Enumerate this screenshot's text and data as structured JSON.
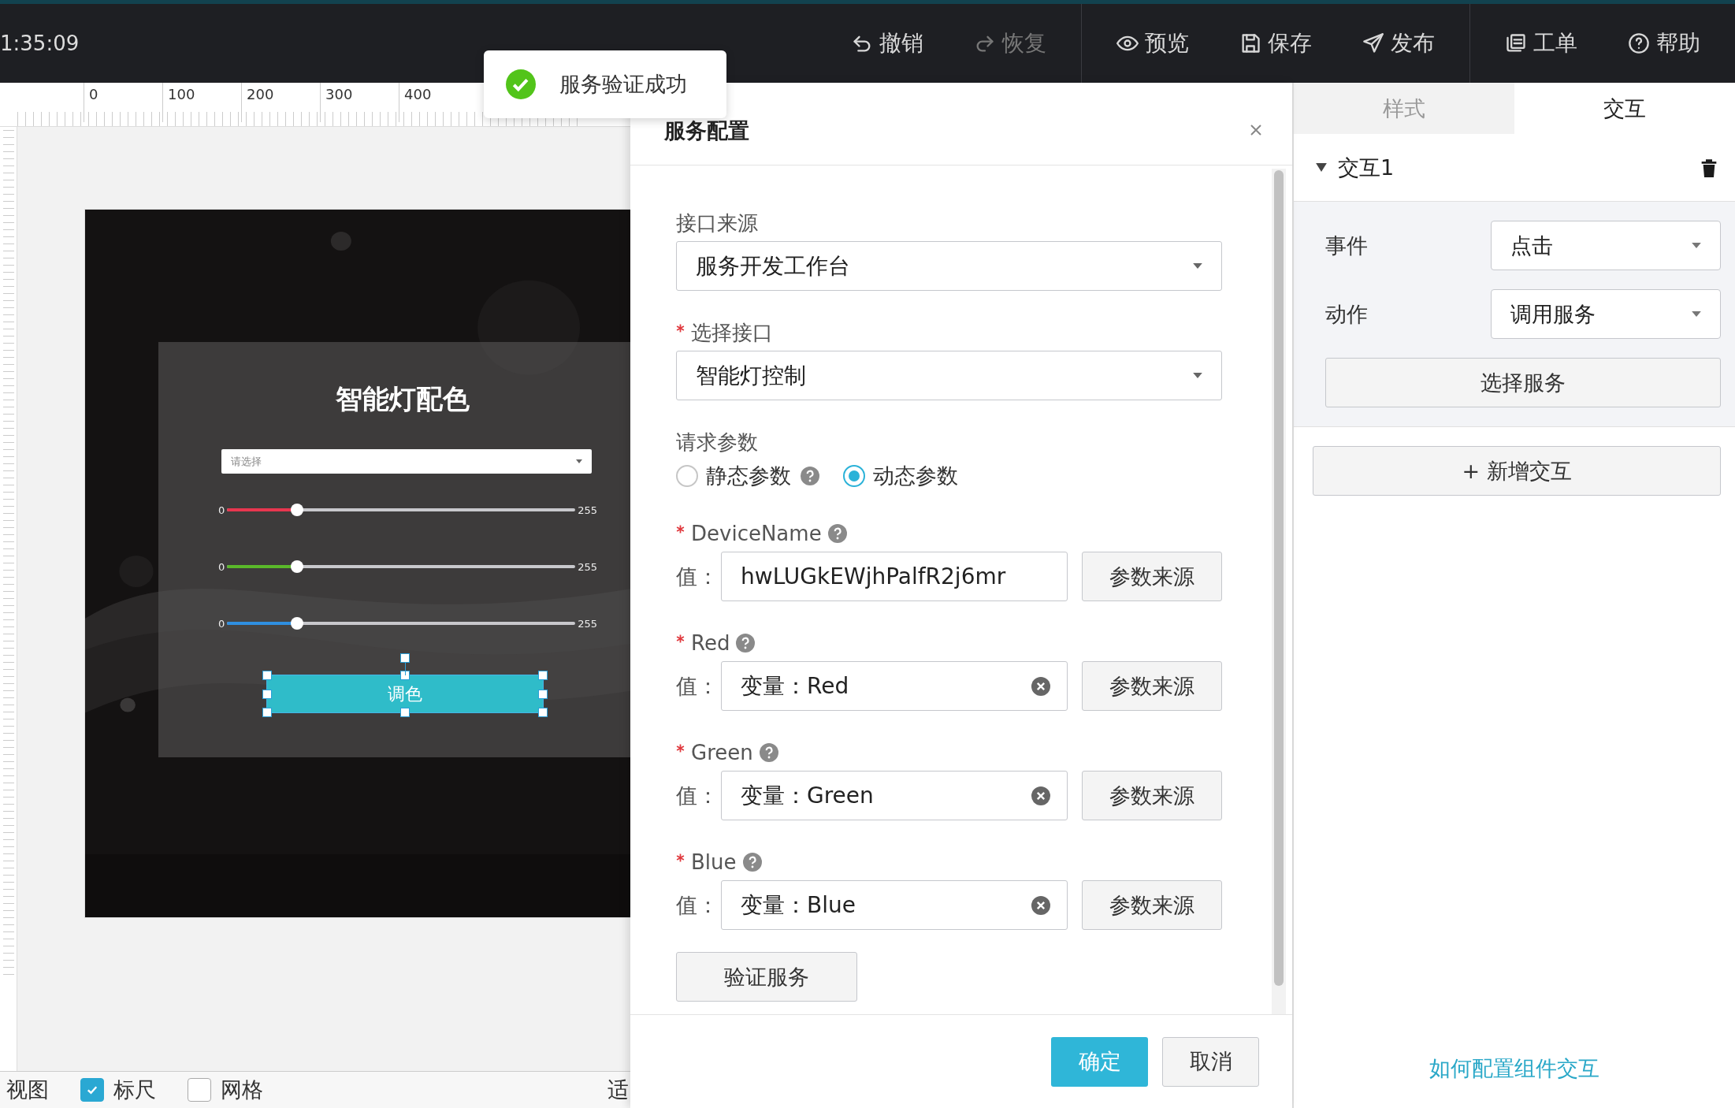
{
  "top_bar": {
    "time": "1:35:09",
    "action_groups": [
      [
        {
          "kind": "undo",
          "label": "撤销",
          "disabled": false
        },
        {
          "kind": "redo",
          "label": "恢复",
          "disabled": true
        }
      ],
      [
        {
          "kind": "preview",
          "label": "预览",
          "disabled": false
        },
        {
          "kind": "save",
          "label": "保存",
          "disabled": false
        },
        {
          "kind": "publish",
          "label": "发布",
          "disabled": false
        }
      ],
      [
        {
          "kind": "ticket",
          "label": "工单",
          "disabled": false
        },
        {
          "kind": "help",
          "label": "帮助",
          "disabled": false
        }
      ]
    ]
  },
  "toast": {
    "text": "服务验证成功"
  },
  "ruler": {
    "labels": [
      "0",
      "100",
      "200",
      "300",
      "400"
    ]
  },
  "preview": {
    "title": "智能灯配色",
    "select": {
      "placeholder": "请选择"
    },
    "sliders": [
      {
        "min": "0",
        "max": "255",
        "level": 0.2,
        "color": "#e8364f"
      },
      {
        "min": "0",
        "max": "255",
        "level": 0.2,
        "color": "#5ab82a"
      },
      {
        "min": "0",
        "max": "255",
        "level": 0.2,
        "color": "#2f8fe0"
      }
    ],
    "button": {
      "label": "调色",
      "selected": true
    }
  },
  "view_bar": {
    "label": "视图",
    "options": [
      {
        "label": "标尺",
        "checked": true
      },
      {
        "label": "网格",
        "checked": false
      }
    ],
    "fit": "适"
  },
  "dialog": {
    "title": "服务配置",
    "fields": [
      {
        "kind": "select",
        "label": "接口来源",
        "required": false,
        "value": "服务开发工作台"
      },
      {
        "kind": "select",
        "label": "选择接口",
        "required": true,
        "value": "智能灯控制"
      },
      {
        "kind": "radio",
        "label": "请求参数",
        "options": [
          {
            "label": "静态参数",
            "help": true,
            "selected": false
          },
          {
            "label": "动态参数",
            "help": false,
            "selected": true
          }
        ]
      },
      {
        "kind": "param",
        "label": "DeviceName",
        "required": true,
        "help": true,
        "value_label": "值：",
        "value": "hwLUGkEWjhPalfR2j6mr",
        "clearable": false,
        "button": "参数来源"
      },
      {
        "kind": "param",
        "label": "Red",
        "required": true,
        "help": true,
        "value_label": "值：",
        "value": "变量：Red",
        "clearable": true,
        "button": "参数来源"
      },
      {
        "kind": "param",
        "label": "Green",
        "required": true,
        "help": true,
        "value_label": "值：",
        "value": "变量：Green",
        "clearable": true,
        "button": "参数来源"
      },
      {
        "kind": "param",
        "label": "Blue",
        "required": true,
        "help": true,
        "value_label": "值：",
        "value": "变量：Blue",
        "clearable": true,
        "button": "参数来源"
      }
    ],
    "verify_button": "验证服务",
    "buttons": [
      {
        "kind": "primary",
        "label": "确定"
      },
      {
        "kind": "default",
        "label": "取消"
      }
    ]
  },
  "right_panel": {
    "tabs": [
      {
        "label": "样式",
        "selected": false
      },
      {
        "label": "交互",
        "selected": true
      }
    ],
    "interaction": {
      "title": "交互1",
      "expanded": true,
      "rows": [
        {
          "label": "事件",
          "value": "点击"
        },
        {
          "label": "动作",
          "value": "调用服务"
        }
      ],
      "button": "选择服务"
    },
    "add_button": "+ 新增交互",
    "help_link": "如何配置组件交互"
  }
}
